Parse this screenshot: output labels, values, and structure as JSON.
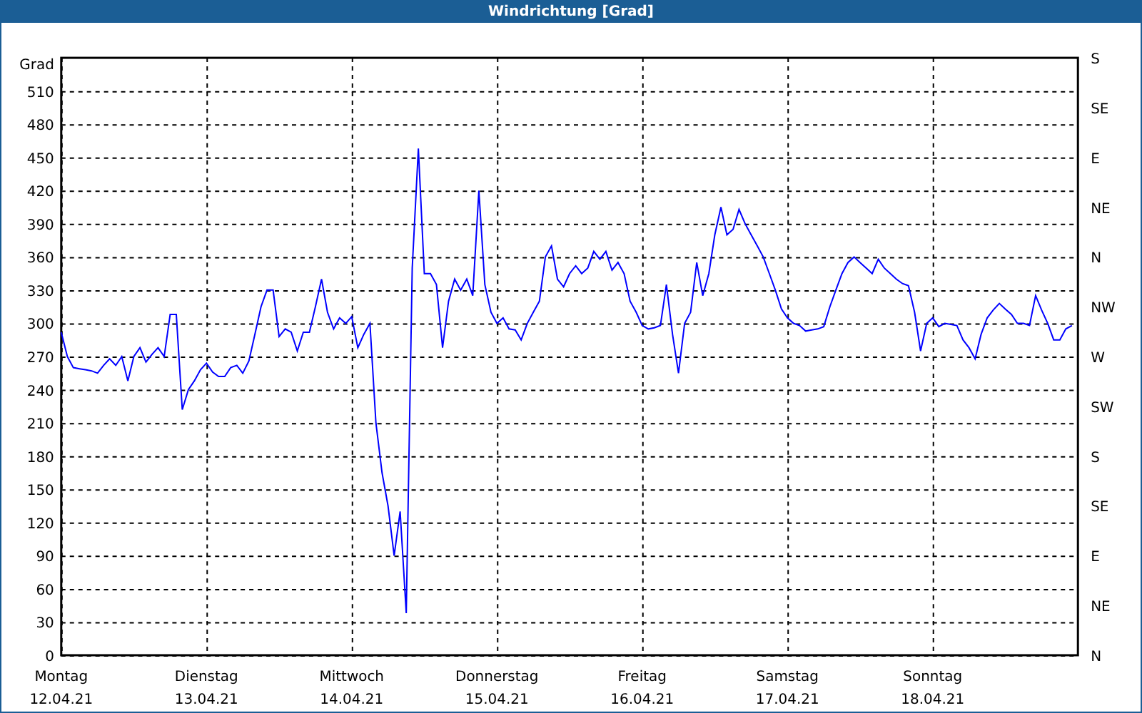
{
  "window": {
    "title": "Windrichtung [Grad]"
  },
  "chart": {
    "chart_data": {
      "type": "line",
      "grid": true,
      "ylabel": "Grad",
      "ylim": [
        0,
        540
      ],
      "yticks": [
        0,
        30,
        60,
        90,
        120,
        150,
        180,
        210,
        240,
        270,
        300,
        330,
        360,
        390,
        420,
        450,
        480,
        510
      ],
      "categories": [
        "Montag",
        null,
        null,
        null,
        null,
        null,
        null,
        null,
        null,
        null,
        null,
        null,
        null,
        null,
        null,
        null,
        null,
        null,
        null,
        null,
        null,
        null,
        null,
        null,
        "Dienstag",
        null,
        null,
        null,
        null,
        null,
        null,
        null,
        null,
        null,
        null,
        null,
        null,
        null,
        null,
        null,
        null,
        null,
        null,
        null,
        null,
        null,
        null,
        null,
        "Mittwoch",
        null,
        null,
        null,
        null,
        null,
        null,
        null,
        null,
        null,
        null,
        null,
        null,
        null,
        null,
        null,
        null,
        null,
        null,
        null,
        null,
        null,
        null,
        null,
        "Donnerstag",
        null,
        null,
        null,
        null,
        null,
        null,
        null,
        null,
        null,
        null,
        null,
        null,
        null,
        null,
        null,
        null,
        null,
        null,
        null,
        null,
        null,
        null,
        null,
        "Freitag",
        null,
        null,
        null,
        null,
        null,
        null,
        null,
        null,
        null,
        null,
        null,
        null,
        null,
        null,
        null,
        null,
        null,
        null,
        null,
        null,
        null,
        null,
        null,
        "Samstag",
        null,
        null,
        null,
        null,
        null,
        null,
        null,
        null,
        null,
        null,
        null,
        null,
        null,
        null,
        null,
        null,
        null,
        null,
        null,
        null,
        null,
        null,
        null,
        "Sonntag",
        null,
        null,
        null,
        null,
        null,
        null,
        null,
        null,
        null,
        null,
        null,
        null,
        null,
        null,
        null,
        null,
        null,
        null,
        null,
        null,
        null,
        null,
        null
      ],
      "series": [
        {
          "color": "#0000ff",
          "values": [
            292,
            270,
            260,
            259,
            258,
            257,
            255,
            262,
            268,
            262,
            270,
            248,
            270,
            278,
            265,
            272,
            278,
            270,
            308,
            308,
            222,
            240,
            248,
            258,
            264,
            256,
            252,
            252,
            260,
            262,
            255,
            266,
            290,
            315,
            330,
            330,
            288,
            295,
            292,
            275,
            292,
            292,
            315,
            340,
            310,
            295,
            305,
            300,
            306,
            278,
            290,
            300,
            210,
            165,
            135,
            90,
            130,
            38,
            350,
            458,
            345,
            345,
            335,
            278,
            320,
            340,
            330,
            340,
            325,
            420,
            335,
            310,
            300,
            305,
            295,
            294,
            285,
            300,
            310,
            320,
            360,
            370,
            340,
            333,
            345,
            352,
            345,
            350,
            365,
            358,
            365,
            348,
            355,
            345,
            320,
            310,
            298,
            295,
            296,
            298,
            335,
            290,
            255,
            300,
            310,
            355,
            325,
            345,
            380,
            405,
            380,
            385,
            403,
            390,
            380,
            370,
            360,
            345,
            330,
            313,
            305,
            300,
            298,
            293,
            294,
            295,
            297,
            315,
            330,
            345,
            355,
            360,
            355,
            350,
            345,
            358,
            350,
            345,
            340,
            336,
            334,
            310,
            275,
            300,
            305,
            297,
            300,
            299,
            298,
            285,
            278,
            268,
            290,
            305,
            312,
            318,
            313,
            308,
            300,
            300,
            298,
            325,
            312,
            300,
            285,
            285,
            295,
            298
          ]
        }
      ]
    },
    "date_labels": [
      "12.04.21",
      "13.04.21",
      "14.04.21",
      "15.04.21",
      "16.04.21",
      "17.04.21",
      "18.04.21"
    ],
    "compass_labels": [
      "S",
      "SE",
      "E",
      "NE",
      "N",
      "NW",
      "W",
      "SW",
      "S",
      "SE",
      "E",
      "NE",
      "N"
    ]
  }
}
